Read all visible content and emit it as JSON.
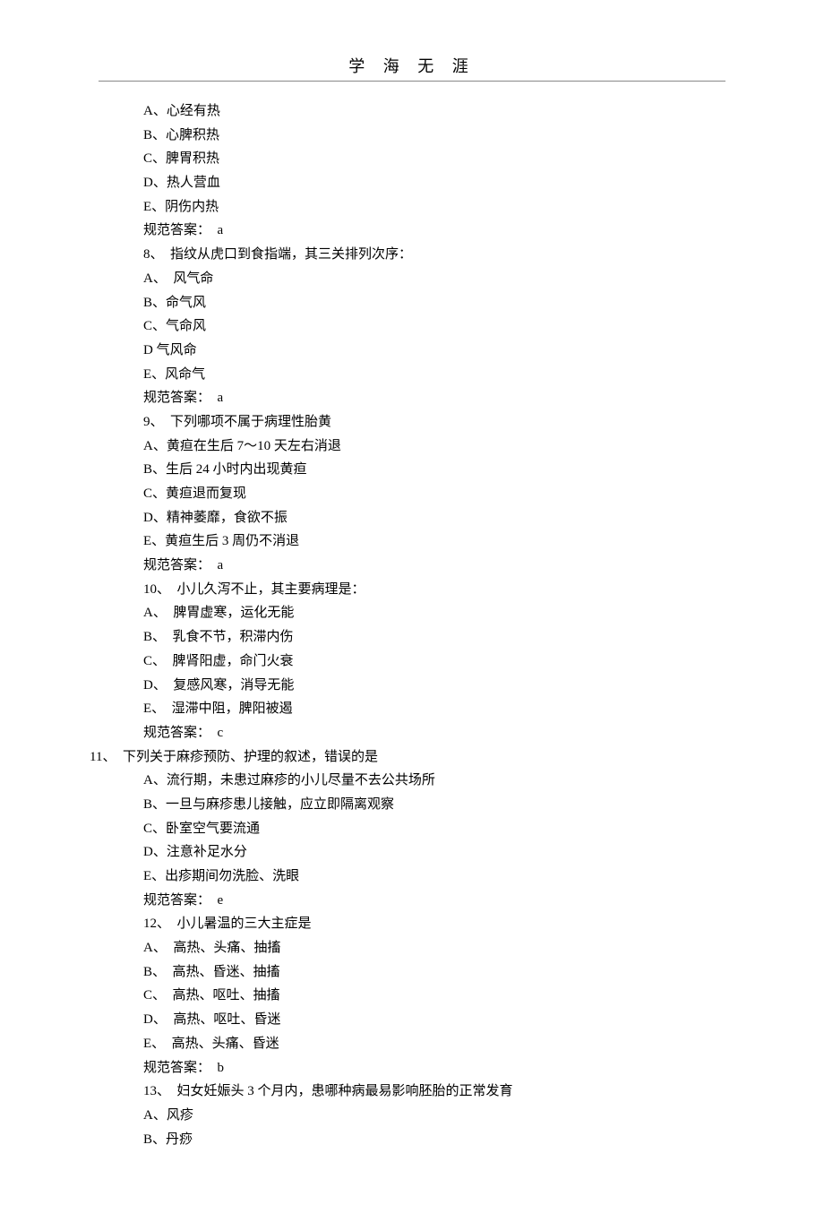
{
  "header": {
    "title": "学 海 无  涯"
  },
  "body": {
    "lines": [
      {
        "cls": "indent1",
        "text": "A、心经有热"
      },
      {
        "cls": "indent1",
        "text": "B、心脾积热"
      },
      {
        "cls": "indent1",
        "text": "C、脾胃积热"
      },
      {
        "cls": "indent1",
        "text": "D、热人营血"
      },
      {
        "cls": "indent1",
        "text": "E、阴伤内热"
      },
      {
        "cls": "indent1",
        "text": "规范答案：  a"
      },
      {
        "cls": "indent1",
        "text": "8、  指纹从虎口到食指端，其三关排列次序："
      },
      {
        "cls": "indent1",
        "text": "A、  风气命"
      },
      {
        "cls": "indent1",
        "text": "B、命气风"
      },
      {
        "cls": "indent1",
        "text": "C、气命风"
      },
      {
        "cls": "indent1",
        "text": "D 气风命"
      },
      {
        "cls": "indent1",
        "text": "E、风命气"
      },
      {
        "cls": "indent1",
        "text": "规范答案：  a"
      },
      {
        "cls": "indent1",
        "text": "9、  下列哪项不属于病理性胎黄"
      },
      {
        "cls": "indent1",
        "text": "A、黄疸在生后 7～10 天左右消退"
      },
      {
        "cls": "indent1",
        "text": "B、生后 24 小时内出现黄疸"
      },
      {
        "cls": "indent1",
        "text": "C、黄疸退而复现"
      },
      {
        "cls": "indent1",
        "text": "D、精神萎靡，食欲不振"
      },
      {
        "cls": "indent1",
        "text": "E、黄疸生后 3 周仍不消退"
      },
      {
        "cls": "indent1",
        "text": "规范答案：  a"
      },
      {
        "cls": "indent1",
        "text": "10、  小儿久泻不止，其主要病理是："
      },
      {
        "cls": "indent1",
        "text": "A、  脾胃虚寒，运化无能"
      },
      {
        "cls": "indent1",
        "text": "B、  乳食不节，积滞内伤"
      },
      {
        "cls": "indent1",
        "text": "C、  脾肾阳虚，命门火衰"
      },
      {
        "cls": "indent1",
        "text": "D、  复感风寒，消导无能"
      },
      {
        "cls": "indent1",
        "text": "E、  湿滞中阻，脾阳被遏"
      },
      {
        "cls": "indent1",
        "text": "规范答案：  c"
      },
      {
        "cls": "indent0",
        "text": "11、  下列关于麻疹预防、护理的叙述，错误的是"
      },
      {
        "cls": "indent1",
        "text": "A、流行期，未患过麻疹的小儿尽量不去公共场所"
      },
      {
        "cls": "indent1",
        "text": "B、一旦与麻疹患儿接触，应立即隔离观察"
      },
      {
        "cls": "indent1",
        "text": "C、卧室空气要流通"
      },
      {
        "cls": "indent1",
        "text": "D、注意补足水分"
      },
      {
        "cls": "indent1",
        "text": "E、出疹期间勿洗脸、洗眼"
      },
      {
        "cls": "indent1",
        "text": "规范答案：  e"
      },
      {
        "cls": "indent1",
        "text": "12、  小儿暑温的三大主症是"
      },
      {
        "cls": "indent1",
        "text": "A、  高热、头痛、抽搐"
      },
      {
        "cls": "indent1",
        "text": "B、  高热、昏迷、抽搐"
      },
      {
        "cls": "indent1",
        "text": "C、  高热、呕吐、抽搐"
      },
      {
        "cls": "indent1",
        "text": "D、  高热、呕吐、昏迷"
      },
      {
        "cls": "indent1",
        "text": "E、  高热、头痛、昏迷"
      },
      {
        "cls": "indent1",
        "text": "规范答案：  b"
      },
      {
        "cls": "indent1",
        "text": "13、  妇女妊娠头 3 个月内，患哪种病最易影响胚胎的正常发育"
      },
      {
        "cls": "indent1",
        "text": "A、风疹"
      },
      {
        "cls": "indent1",
        "text": "B、丹痧"
      }
    ]
  }
}
